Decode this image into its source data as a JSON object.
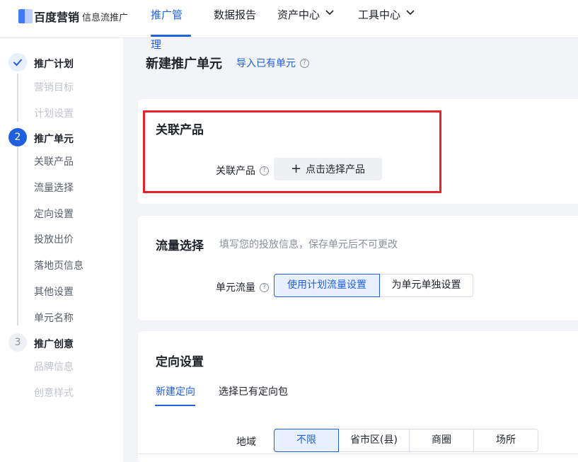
{
  "header": {
    "brand": "百度营销",
    "product": "信息流推广",
    "nav": [
      {
        "label": "推广管理",
        "active": true
      },
      {
        "label": "数据报告"
      },
      {
        "label": "资产中心",
        "dropdown": true
      },
      {
        "label": "工具中心",
        "dropdown": true
      }
    ]
  },
  "sidebar": {
    "steps": [
      {
        "num": "1",
        "title": "推广计划",
        "status": "done",
        "items": [
          "营销目标",
          "计划设置"
        ]
      },
      {
        "num": "2",
        "title": "推广单元",
        "status": "active",
        "items": [
          "关联产品",
          "流量选择",
          "定向设置",
          "投放出价",
          "落地页信息",
          "其他设置",
          "单元名称"
        ]
      },
      {
        "num": "3",
        "title": "推广创意",
        "status": "todo",
        "items": [
          "品牌信息",
          "创意样式"
        ]
      }
    ]
  },
  "page": {
    "title": "新建推广单元",
    "import_link": "导入已有单元"
  },
  "product_card": {
    "title": "关联产品",
    "field_label": "关联产品",
    "add_button": "点击选择产品"
  },
  "traffic_card": {
    "title": "流量选择",
    "hint": "填写您的投放信息，保存单元后不可更改",
    "field_label": "单元流量",
    "options": [
      "使用计划流量设置",
      "为单元单独设置"
    ],
    "selected": "使用计划流量设置"
  },
  "targeting_card": {
    "title": "定向设置",
    "tabs": [
      "新建定向",
      "选择已有定向包"
    ],
    "active_tab": "新建定向",
    "region_label": "地域",
    "region_options": [
      "不限",
      "省市区(县)",
      "商圈",
      "场所"
    ],
    "region_selected": "不限"
  },
  "colors": {
    "accent": "#1f5fe0",
    "highlight_box": "#e8212a"
  }
}
